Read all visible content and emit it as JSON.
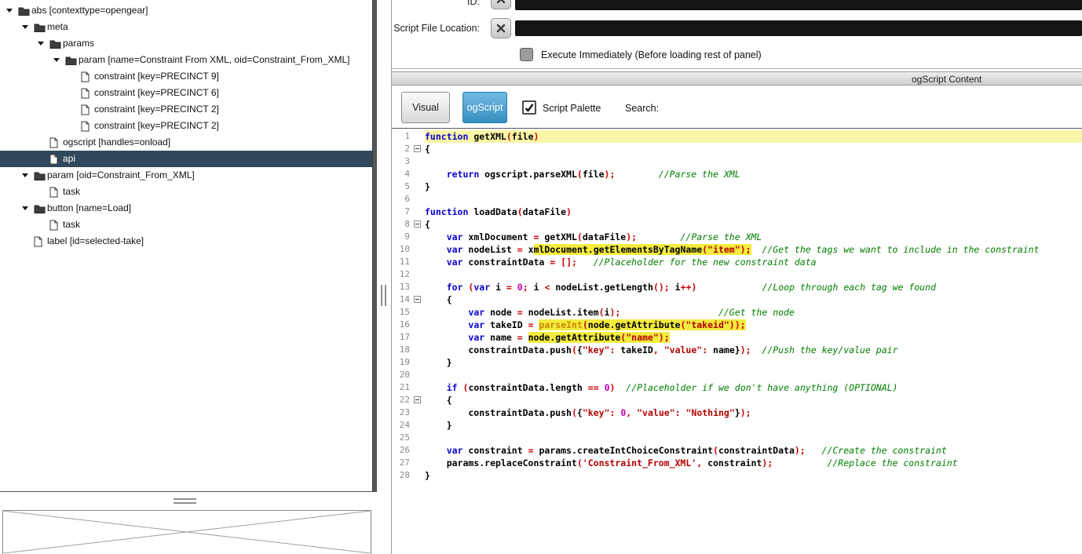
{
  "tree": {
    "items": [
      {
        "label": "abs [contexttype=opengear]",
        "depth": 0,
        "kind": "folder",
        "expandable": true
      },
      {
        "label": "meta",
        "depth": 1,
        "kind": "folder",
        "expandable": true
      },
      {
        "label": "params",
        "depth": 2,
        "kind": "folder",
        "expandable": true
      },
      {
        "label": "param [name=Constraint From XML, oid=Constraint_From_XML]",
        "depth": 3,
        "kind": "folder",
        "expandable": true
      },
      {
        "label": "constraint [key=PRECINCT 9]",
        "depth": 4,
        "kind": "file"
      },
      {
        "label": "constraint [key=PRECINCT 6]",
        "depth": 4,
        "kind": "file"
      },
      {
        "label": "constraint [key=PRECINCT 2]",
        "depth": 4,
        "kind": "file"
      },
      {
        "label": "constraint [key=PRECINCT 2]",
        "depth": 4,
        "kind": "file"
      },
      {
        "label": "ogscript [handles=onload]",
        "depth": 2,
        "kind": "file"
      },
      {
        "label": "api",
        "depth": 2,
        "kind": "file",
        "selected": true
      },
      {
        "label": "param [oid=Constraint_From_XML]",
        "depth": 1,
        "kind": "folder",
        "expandable": true
      },
      {
        "label": "task",
        "depth": 2,
        "kind": "file"
      },
      {
        "label": "button [name=Load]",
        "depth": 1,
        "kind": "folder",
        "expandable": true
      },
      {
        "label": "task",
        "depth": 2,
        "kind": "file"
      },
      {
        "label": "label [id=selected-take]",
        "depth": 1,
        "kind": "file"
      }
    ]
  },
  "form": {
    "id_label": "ID:",
    "id_value": "",
    "script_file_label": "Script File Location:",
    "script_file_value": "",
    "execute_label": "Execute Immediately (Before loading rest of panel)",
    "execute_checked": false
  },
  "content": {
    "header": "ogScript Content",
    "tabs": [
      {
        "label": "Visual",
        "active": false
      },
      {
        "label": "ogScript",
        "active": true
      }
    ],
    "script_palette_label": "Script Palette",
    "script_palette_checked": true,
    "search_label": "Search:",
    "search_value": ""
  },
  "ui_colors": {
    "tree_selection": "#31485c",
    "active_tab": "#3b9fd4",
    "field_background": "#151515"
  },
  "editor": {
    "colors": {
      "keyword": "#0a00cc",
      "operator": "#cc0000",
      "string": "#b40000",
      "comment": "#007e00",
      "number": "#c000b4",
      "builtin": "#cc8800",
      "line_highlight": "#fbf7a8",
      "token_highlight": "#f3ec3f"
    },
    "lines": [
      {
        "hl": true,
        "tk": [
          [
            "function",
            "k"
          ],
          [
            " getXML",
            "p"
          ],
          [
            "(",
            "o"
          ],
          [
            "file",
            "p"
          ],
          [
            ")",
            "o"
          ]
        ]
      },
      {
        "fold": true,
        "tk": [
          [
            "{",
            "p"
          ]
        ]
      },
      {
        "tk": []
      },
      {
        "tk": [
          [
            "    ",
            "p"
          ],
          [
            "return",
            "k"
          ],
          [
            " ogscript.parseXML",
            "p"
          ],
          [
            "(",
            "o"
          ],
          [
            "file",
            "p"
          ],
          [
            ");",
            "o"
          ],
          [
            "        ",
            "p"
          ],
          [
            "//Parse the XML",
            "c"
          ]
        ]
      },
      {
        "tk": [
          [
            "}",
            "p"
          ]
        ]
      },
      {
        "tk": []
      },
      {
        "tk": [
          [
            "function",
            "k"
          ],
          [
            " loadData",
            "p"
          ],
          [
            "(",
            "o"
          ],
          [
            "dataFile",
            "p"
          ],
          [
            ")",
            "o"
          ]
        ]
      },
      {
        "fold": true,
        "tk": [
          [
            "{",
            "p"
          ]
        ]
      },
      {
        "tk": [
          [
            "    ",
            "p"
          ],
          [
            "var",
            "k"
          ],
          [
            " xmlDocument ",
            "p"
          ],
          [
            "=",
            "o"
          ],
          [
            " getXML",
            "p"
          ],
          [
            "(",
            "o"
          ],
          [
            "dataFile",
            "p"
          ],
          [
            ");",
            "o"
          ],
          [
            "        ",
            "p"
          ],
          [
            "//Parse the XML",
            "c"
          ]
        ]
      },
      {
        "tk": [
          [
            "    ",
            "p"
          ],
          [
            "var",
            "k"
          ],
          [
            " nodeList ",
            "p"
          ],
          [
            "=",
            "o"
          ],
          [
            " x",
            "p"
          ],
          [
            "mlDocument.getElementsByTagName",
            "p",
            1
          ],
          [
            "(",
            "o",
            1
          ],
          [
            "\"item\"",
            "s",
            1
          ],
          [
            ");",
            "o",
            1
          ],
          [
            "  ",
            "p"
          ],
          [
            "//Get the tags we want to include in the constraint",
            "c"
          ]
        ]
      },
      {
        "tk": [
          [
            "    ",
            "p"
          ],
          [
            "var",
            "k"
          ],
          [
            " constraintData ",
            "p"
          ],
          [
            "=",
            "o"
          ],
          [
            " ",
            "p"
          ],
          [
            "[];",
            "o"
          ],
          [
            "   ",
            "p"
          ],
          [
            "//Placeholder for the new constraint data",
            "c"
          ]
        ]
      },
      {
        "tk": []
      },
      {
        "tk": [
          [
            "    ",
            "p"
          ],
          [
            "for",
            "k"
          ],
          [
            " ",
            "p"
          ],
          [
            "(",
            "o"
          ],
          [
            "var",
            "k"
          ],
          [
            " i ",
            "p"
          ],
          [
            "=",
            "o"
          ],
          [
            " ",
            "p"
          ],
          [
            "0",
            "n"
          ],
          [
            ";",
            "o"
          ],
          [
            " i ",
            "p"
          ],
          [
            "<",
            "o"
          ],
          [
            " nodeList.getLength",
            "p"
          ],
          [
            "();",
            "o"
          ],
          [
            " i",
            "p"
          ],
          [
            "++)",
            "o"
          ],
          [
            "            ",
            "p"
          ],
          [
            "//Loop through each tag we found",
            "c"
          ]
        ]
      },
      {
        "fold": true,
        "tk": [
          [
            "    {",
            "p"
          ]
        ]
      },
      {
        "tk": [
          [
            "        ",
            "p"
          ],
          [
            "var",
            "k"
          ],
          [
            " node ",
            "p"
          ],
          [
            "=",
            "o"
          ],
          [
            " nodeList.item",
            "p"
          ],
          [
            "(",
            "o"
          ],
          [
            "i",
            "p"
          ],
          [
            ");",
            "o"
          ],
          [
            "                  ",
            "p"
          ],
          [
            "//Get the node",
            "c"
          ]
        ]
      },
      {
        "tk": [
          [
            "        ",
            "p"
          ],
          [
            "var",
            "k"
          ],
          [
            " takeID ",
            "p"
          ],
          [
            "=",
            "o"
          ],
          [
            " ",
            "p"
          ],
          [
            "parseInt",
            "f",
            1
          ],
          [
            "(",
            "o",
            1
          ],
          [
            "node.getAttribute",
            "p",
            1
          ],
          [
            "(",
            "o",
            1
          ],
          [
            "\"takeid\"",
            "s",
            1
          ],
          [
            "));",
            "o",
            1
          ]
        ]
      },
      {
        "tk": [
          [
            "        ",
            "p"
          ],
          [
            "var",
            "k"
          ],
          [
            " name ",
            "p"
          ],
          [
            "=",
            "o"
          ],
          [
            " ",
            "p"
          ],
          [
            "node.getAttribute",
            "p",
            1
          ],
          [
            "(",
            "o",
            1
          ],
          [
            "\"name\"",
            "s",
            1
          ],
          [
            ");",
            "o",
            1
          ]
        ]
      },
      {
        "tk": [
          [
            "        constraintData.push",
            "p"
          ],
          [
            "(",
            "o"
          ],
          [
            "{",
            "p"
          ],
          [
            "\"key\"",
            "s"
          ],
          [
            ":",
            "o"
          ],
          [
            " takeID",
            "p"
          ],
          [
            ",",
            "o"
          ],
          [
            " ",
            "p"
          ],
          [
            "\"value\"",
            "s"
          ],
          [
            ":",
            "o"
          ],
          [
            " name",
            "p"
          ],
          [
            "}",
            "p"
          ],
          [
            ");",
            "o"
          ],
          [
            "  ",
            "p"
          ],
          [
            "//Push the key/value pair",
            "c"
          ]
        ]
      },
      {
        "tk": [
          [
            "    }",
            "p"
          ]
        ]
      },
      {
        "tk": []
      },
      {
        "tk": [
          [
            "    ",
            "p"
          ],
          [
            "if",
            "k"
          ],
          [
            " ",
            "p"
          ],
          [
            "(",
            "o"
          ],
          [
            "constraintData.length ",
            "p"
          ],
          [
            "==",
            "o"
          ],
          [
            " ",
            "p"
          ],
          [
            "0",
            "n"
          ],
          [
            ")",
            "o"
          ],
          [
            "  ",
            "p"
          ],
          [
            "//Placeholder if we don't have anything (OPTIONAL)",
            "c"
          ]
        ]
      },
      {
        "fold": true,
        "tk": [
          [
            "    {",
            "p"
          ]
        ]
      },
      {
        "tk": [
          [
            "        constraintData.push",
            "p"
          ],
          [
            "(",
            "o"
          ],
          [
            "{",
            "p"
          ],
          [
            "\"key\"",
            "s"
          ],
          [
            ":",
            "o"
          ],
          [
            " ",
            "p"
          ],
          [
            "0",
            "n"
          ],
          [
            ",",
            "o"
          ],
          [
            " ",
            "p"
          ],
          [
            "\"value\"",
            "s"
          ],
          [
            ":",
            "o"
          ],
          [
            " ",
            "p"
          ],
          [
            "\"Nothing\"",
            "s"
          ],
          [
            "}",
            "p"
          ],
          [
            ");",
            "o"
          ]
        ]
      },
      {
        "tk": [
          [
            "    }",
            "p"
          ]
        ]
      },
      {
        "tk": []
      },
      {
        "tk": [
          [
            "    ",
            "p"
          ],
          [
            "var",
            "k"
          ],
          [
            " constraint ",
            "p"
          ],
          [
            "=",
            "o"
          ],
          [
            " params.createIntChoiceConstraint",
            "p"
          ],
          [
            "(",
            "o"
          ],
          [
            "constraintData",
            "p"
          ],
          [
            ");",
            "o"
          ],
          [
            "   ",
            "p"
          ],
          [
            "//Create the constraint",
            "c"
          ]
        ]
      },
      {
        "tk": [
          [
            "    params.replaceConstraint",
            "p"
          ],
          [
            "(",
            "o"
          ],
          [
            "'Constraint_From_XML'",
            "s"
          ],
          [
            ",",
            "o"
          ],
          [
            " constraint",
            "p"
          ],
          [
            ");",
            "o"
          ],
          [
            "          ",
            "p"
          ],
          [
            "//Replace the constraint",
            "c"
          ]
        ]
      },
      {
        "tk": [
          [
            "}",
            "p"
          ]
        ]
      }
    ]
  }
}
